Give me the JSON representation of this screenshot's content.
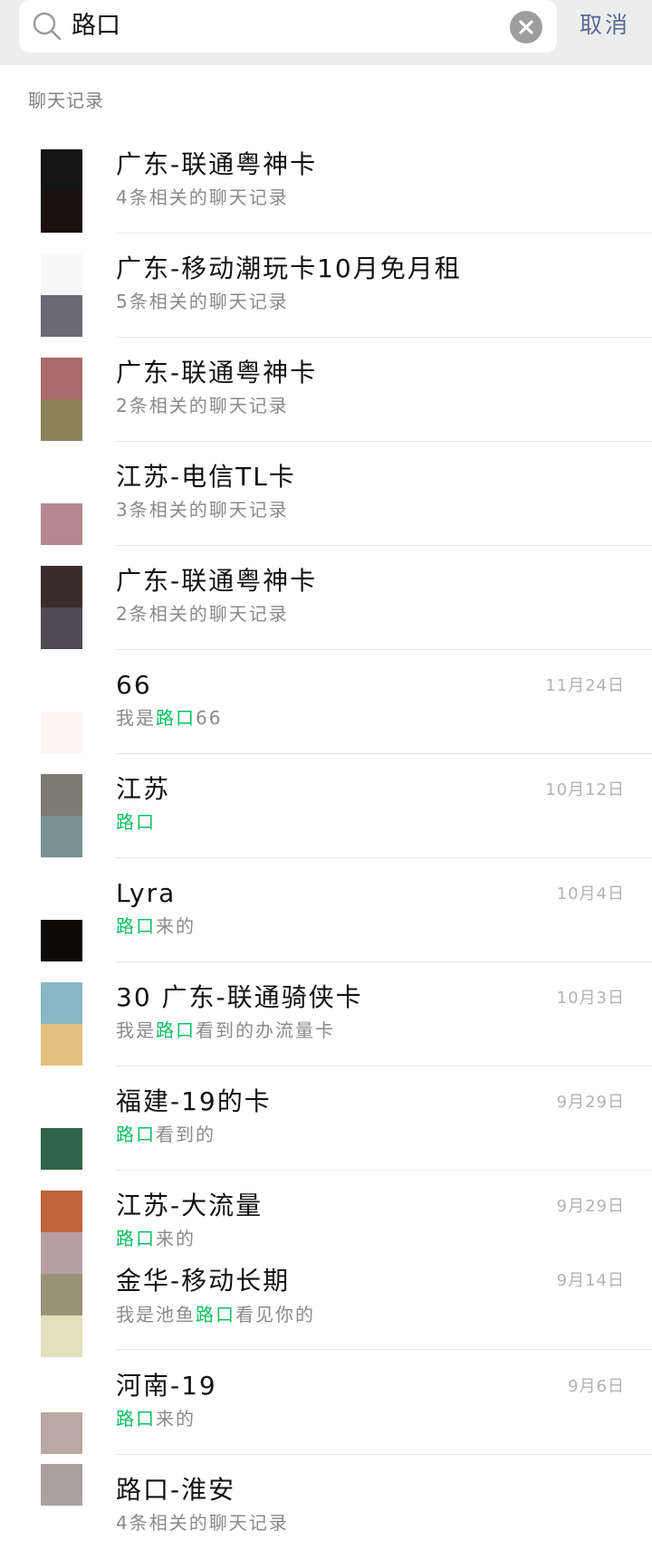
{
  "search": {
    "query": "路口",
    "cancel_label": "取消"
  },
  "section": {
    "title": "聊天记录"
  },
  "results": [
    {
      "title": "广东-联通粤神卡",
      "sub": "4条相关的聊天记录",
      "avatar": [
        "#141414",
        "#1c0f12"
      ]
    },
    {
      "title": "广东-移动潮玩卡10月免月租",
      "sub": "5条相关的聊天记录",
      "avatar": [
        "#f7f7f8",
        "#6b6a72"
      ]
    },
    {
      "title": "广东-联通粤神卡",
      "sub": "2条相关的聊天记录",
      "avatar": [
        "#a86a6a",
        "#8c825a"
      ]
    },
    {
      "title": "江苏-电信TL卡",
      "sub": "3条相关的聊天记录",
      "avatar": [
        "#ffffff",
        "#b5878f"
      ]
    },
    {
      "title": "广东-联通粤神卡",
      "sub": "2条相关的聊天记录",
      "avatar": [
        "#3a2c2b",
        "#4f4b52"
      ]
    },
    {
      "title": "66",
      "sub_prefix": "我是",
      "sub_hl": "路口",
      "sub_suffix": "66",
      "date": "11月24日",
      "avatar": [
        "#ffffff",
        "#fbf5f6"
      ]
    },
    {
      "title": "江苏",
      "sub_prefix": "",
      "sub_hl": "路口",
      "sub_suffix": "",
      "date": "10月12日",
      "avatar": [
        "#7d7a72",
        "#7a9290"
      ]
    },
    {
      "title": "Lyra",
      "sub_prefix": "",
      "sub_hl": "路口",
      "sub_suffix": "来的",
      "date": "10月4日",
      "avatar": [
        "#ffffff",
        "#0b0a08"
      ]
    },
    {
      "title": "30 广东-联通骑侠卡",
      "sub_prefix": "我是",
      "sub_hl": "路口",
      "sub_suffix": "看到的办流量卡",
      "date": "10月3日",
      "avatar": [
        "#88b6c5",
        "#e3c07d"
      ]
    },
    {
      "title": "福建-19的卡",
      "sub_prefix": "",
      "sub_hl": "路口",
      "sub_suffix": "看到的",
      "date": "9月29日",
      "avatar": [
        "#ffffff",
        "#2f6547"
      ]
    },
    {
      "title": "江苏-大流量",
      "sub_prefix": "",
      "sub_hl": "路口",
      "sub_suffix": "来的",
      "date": "9月29日",
      "title2": "金华-移动长期",
      "sub2_prefix": "我是池鱼",
      "sub2_hl": "路口",
      "sub2_suffix": "看见你的",
      "date2": "9月14日",
      "avatar": [
        "#c0643a",
        "#b99ea3",
        "#9a9276",
        "#e0e0bd"
      ]
    },
    {
      "title": "河南-19",
      "sub_prefix": "",
      "sub_hl": "路口",
      "sub_suffix": "来的",
      "date": "9月6日",
      "avatar": [
        "#ffffff",
        "#baa8a3"
      ]
    },
    {
      "title": "路口-淮安",
      "sub": "4条相关的聊天记录",
      "avatar": [
        "#a7a1a0",
        "#ffffff"
      ]
    }
  ]
}
